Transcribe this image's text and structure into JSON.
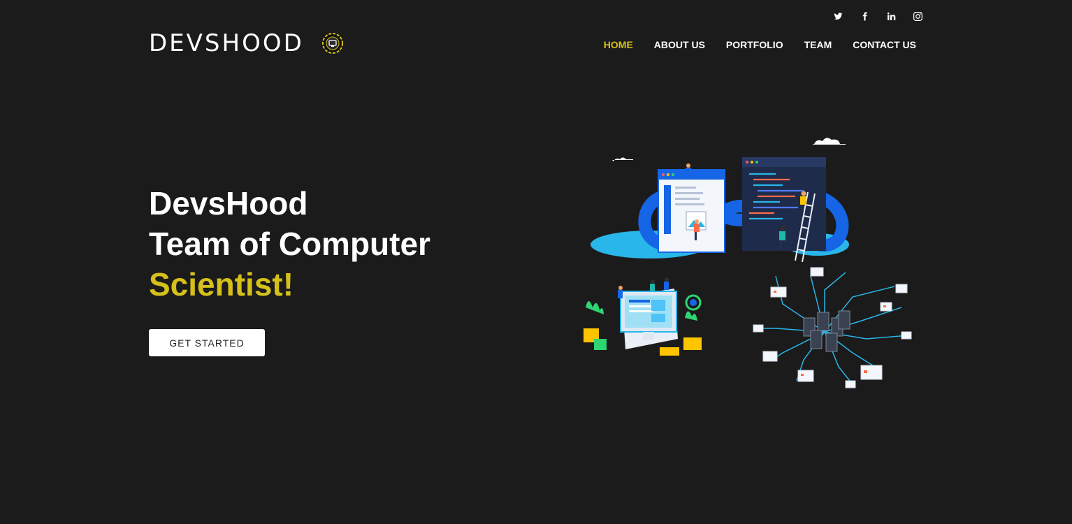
{
  "social": {
    "items": [
      "twitter-icon",
      "facebook-icon",
      "linkedin-icon",
      "instagram-icon"
    ]
  },
  "header": {
    "logo_text": "DEVSHOOD",
    "nav": [
      {
        "label": "HOME",
        "active": true
      },
      {
        "label": "ABOUT US",
        "active": false
      },
      {
        "label": "PORTFOLIO",
        "active": false
      },
      {
        "label": "TEAM",
        "active": false
      },
      {
        "label": "CONTACT US",
        "active": false
      }
    ]
  },
  "hero": {
    "line1": "DevsHood",
    "line2": "Team of Computer",
    "line3": "Scientist!",
    "cta_label": "GET STARTED"
  },
  "colors": {
    "background": "#1b1b1b",
    "accent": "#d6c01a",
    "illustration_blue": "#1565e6",
    "illustration_cyan": "#29b6e8"
  }
}
